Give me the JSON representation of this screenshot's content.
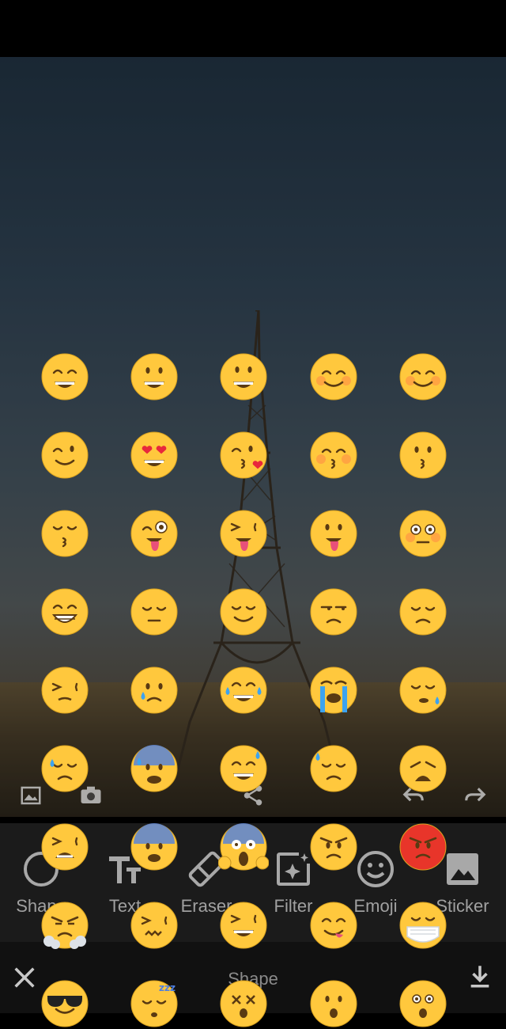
{
  "toolbar": {
    "tools": [
      {
        "label": "Shape",
        "icon": "circle-icon"
      },
      {
        "label": "Text",
        "icon": "text-icon"
      },
      {
        "label": "Eraser",
        "icon": "eraser-icon"
      },
      {
        "label": "Filter",
        "icon": "filter-icon"
      },
      {
        "label": "Emoji",
        "icon": "smiley-icon"
      },
      {
        "label": "Sticker",
        "icon": "image-icon"
      }
    ]
  },
  "photo_tools": {
    "left": [
      "gallery-icon",
      "camera-icon"
    ],
    "center": "share-icon",
    "right": [
      "undo-icon",
      "redo-icon"
    ]
  },
  "bottom_bar": {
    "title": "Shape",
    "close_icon": "close-icon",
    "download_icon": "download-icon"
  },
  "emoji_picker": {
    "columns": 5,
    "emojis": [
      "grinning-face",
      "smiley-face",
      "grinning-face-big-eyes",
      "smiling-face-smiling-eyes",
      "smiling-face-blush",
      "winking-face",
      "heart-eyes-face",
      "face-blowing-kiss",
      "kissing-face-smiling-eyes",
      "kissing-face",
      "kissing-face-closed-eyes",
      "winking-face-tongue",
      "squinting-face-tongue",
      "face-with-tongue",
      "flushed-face",
      "beaming-face",
      "pensive-face",
      "relieved-face",
      "unamused-face",
      "disappointed-face",
      "persevering-face",
      "crying-face",
      "tears-of-joy",
      "loudly-crying-face",
      "sleepy-face",
      "sad-relieved-face",
      "anxious-face-sweat",
      "grinning-face-sweat",
      "downcast-face-sweat",
      "weary-face",
      "tired-face",
      "fearful-face",
      "face-screaming-in-fear",
      "angry-face",
      "pouting-face",
      "face-with-steam",
      "confounded-face",
      "squinting-face",
      "face-savoring-food",
      "face-with-medical-mask",
      "smiling-face-sunglasses",
      "sleeping-face",
      "dizzy-face",
      "hushed-face",
      "astonished-face"
    ]
  },
  "colors": {
    "emoji_yellow": "#ffc83d",
    "toolbar_bg": "#1b1b1b",
    "bottom_bar_bg": "#111111"
  }
}
